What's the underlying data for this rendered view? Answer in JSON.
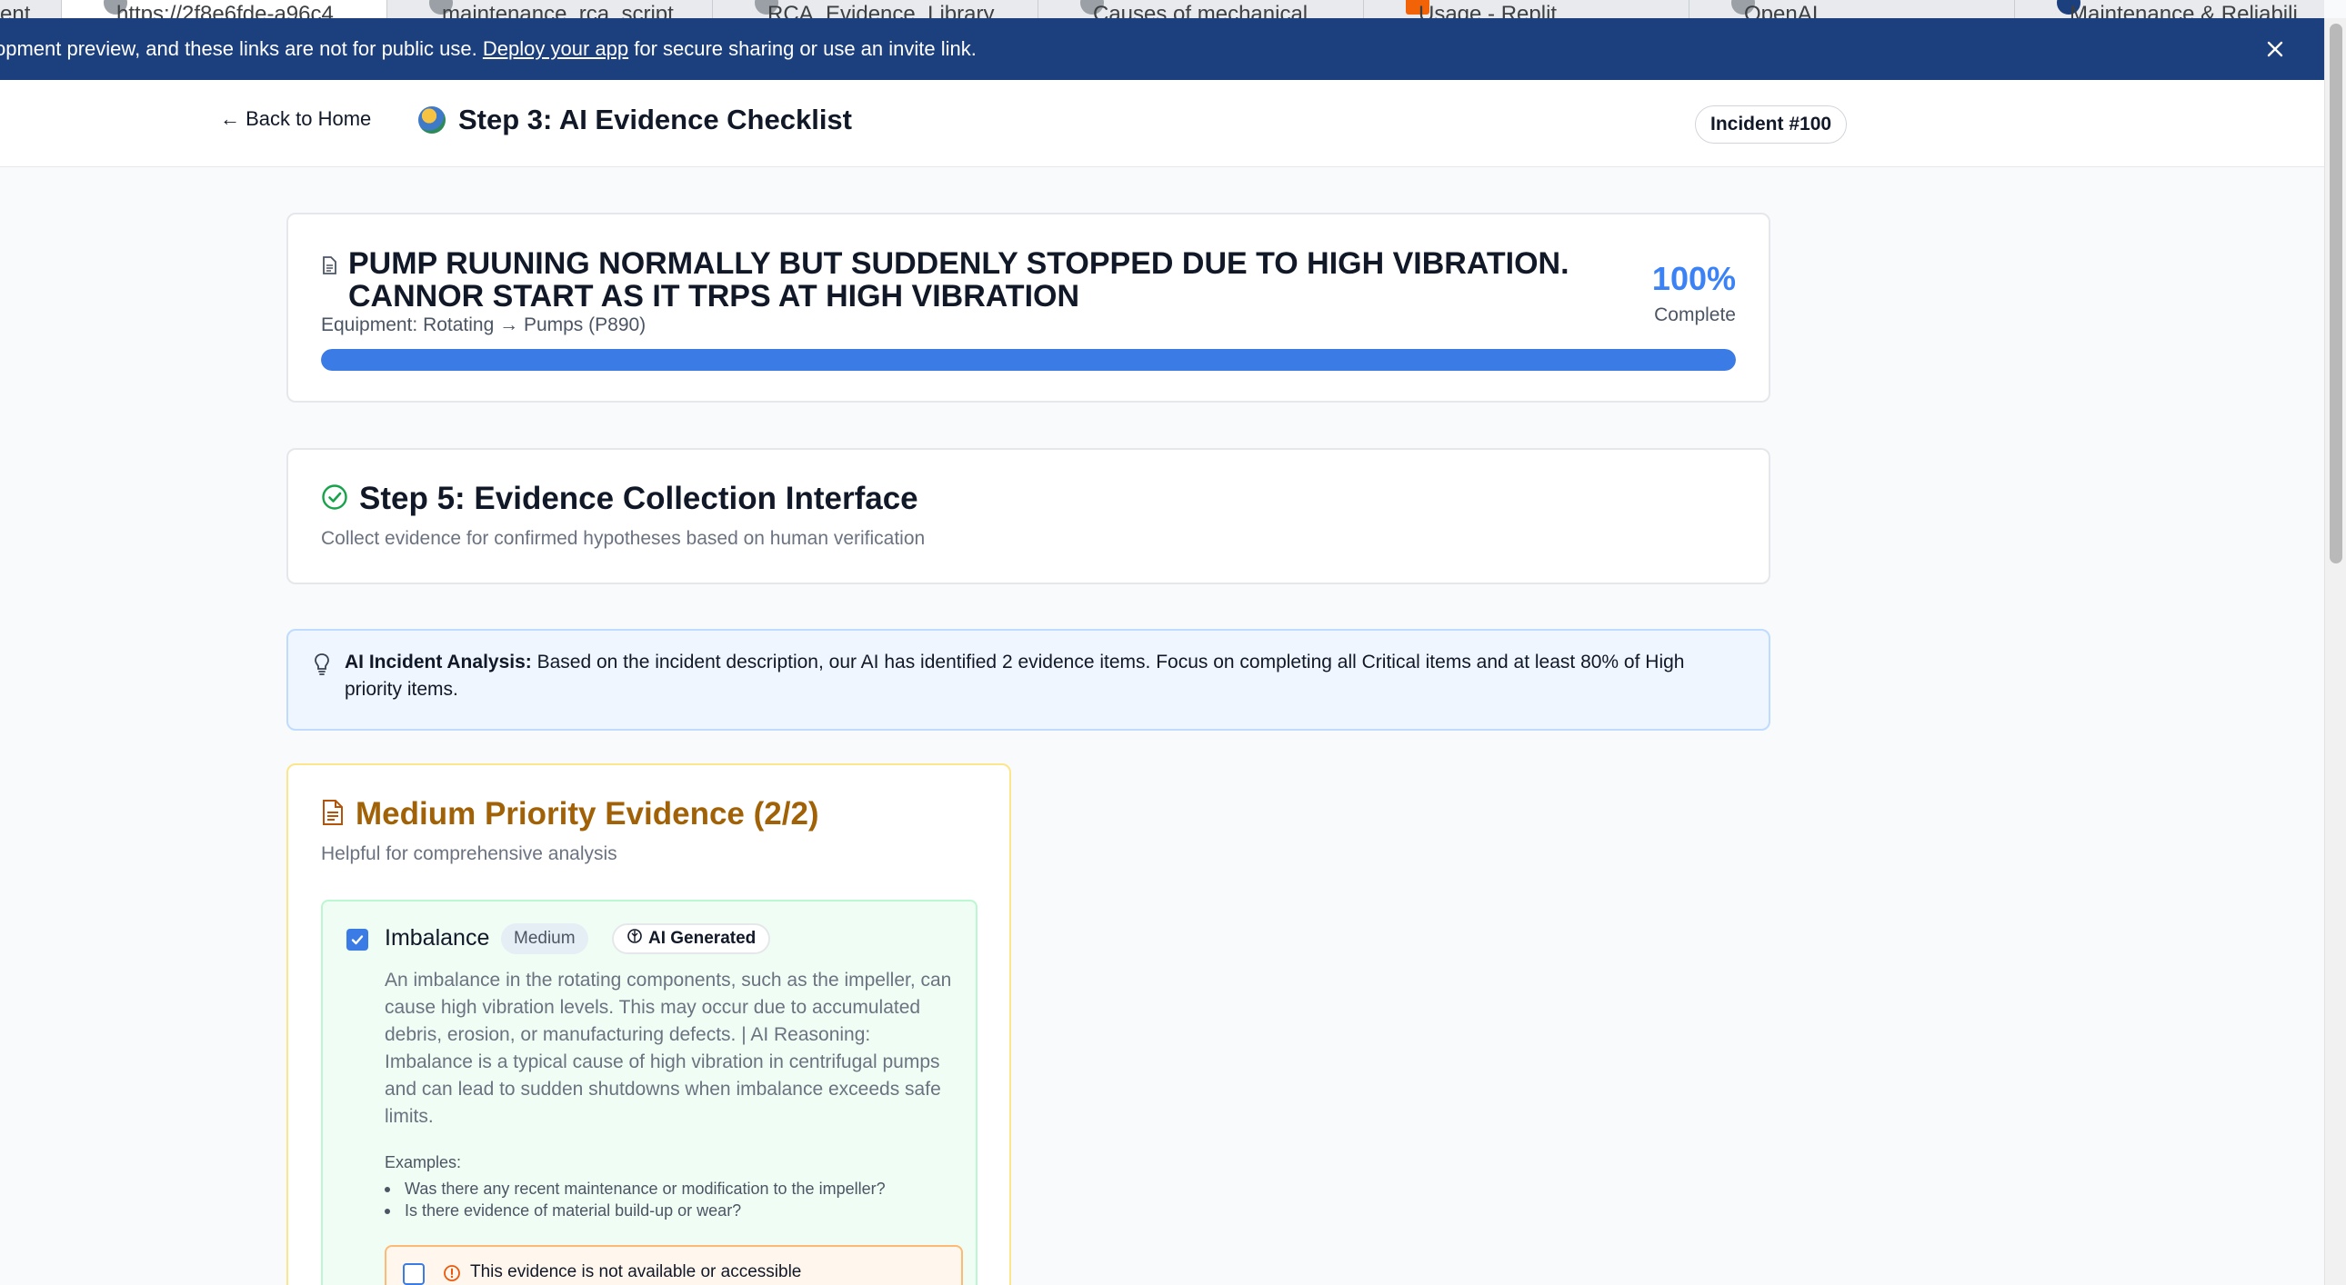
{
  "browser": {
    "tabs": [
      {
        "title": "ent",
        "active": false
      },
      {
        "title": "https://2f8e6fde-a96c4…",
        "active": true
      },
      {
        "title": "maintenance_rca_script…",
        "active": false
      },
      {
        "title": "RCA_Evidence_Library…",
        "active": false
      },
      {
        "title": "Causes of mechanical…",
        "active": false
      },
      {
        "title": "Usage - Replit",
        "active": false
      },
      {
        "title": "OpenAI",
        "active": false
      },
      {
        "title": "Maintenance & Reliabili…",
        "active": false
      }
    ]
  },
  "banner": {
    "text_before": "opment preview, and these links are not for public use.",
    "link": "Deploy your app",
    "text_after": "for secure sharing or use an invite link."
  },
  "header": {
    "back_label": "← Back to Home",
    "title": "Step 3: AI Evidence Checklist",
    "incident_badge": "Incident #100"
  },
  "incident": {
    "title": "PUMP RUUNING NORMALLY BUT SUDDENLY STOPPED DUE TO HIGH VIBRATION. CANNOR START AS IT TRPS AT HIGH VIBRATION",
    "equipment": "Equipment: Rotating → Pumps (P890)",
    "progress_percent": "100%",
    "progress_value": 1.0,
    "progress_label": "Complete"
  },
  "step5": {
    "title": "Step 5: Evidence Collection Interface",
    "subtitle": "Collect evidence for confirmed hypotheses based on human verification"
  },
  "analysis": {
    "label": "AI Incident Analysis:",
    "text": "Based on the incident description, our AI has identified 2 evidence items. Focus on completing all Critical items and at least 80% of High priority items."
  },
  "medium_section": {
    "title": "Medium Priority Evidence (2/2)",
    "subtitle": "Helpful for comprehensive analysis",
    "items": [
      {
        "name": "Imbalance",
        "priority_badge": "Medium",
        "ai_badge": "AI Generated",
        "checked": true,
        "description": "An imbalance in the rotating components, such as the impeller, can cause high vibration levels. This may occur due to accumulated debris, erosion, or manufacturing defects. | AI Reasoning: Imbalance is a typical cause of high vibration in centrifugal pumps and can lead to sudden shutdowns when imbalance exceeds safe limits.",
        "examples_label": "Examples:",
        "examples": [
          "Was there any recent maintenance or modification to the impeller?",
          "Is there evidence of material build-up or wear?"
        ],
        "unavailable_label": "This evidence is not available or accessible"
      }
    ]
  },
  "colors": {
    "banner": "#1c3f7d",
    "accent_blue": "#3b7be6",
    "medium_title": "#a16207",
    "evidence_bg": "#f0fdf4"
  }
}
